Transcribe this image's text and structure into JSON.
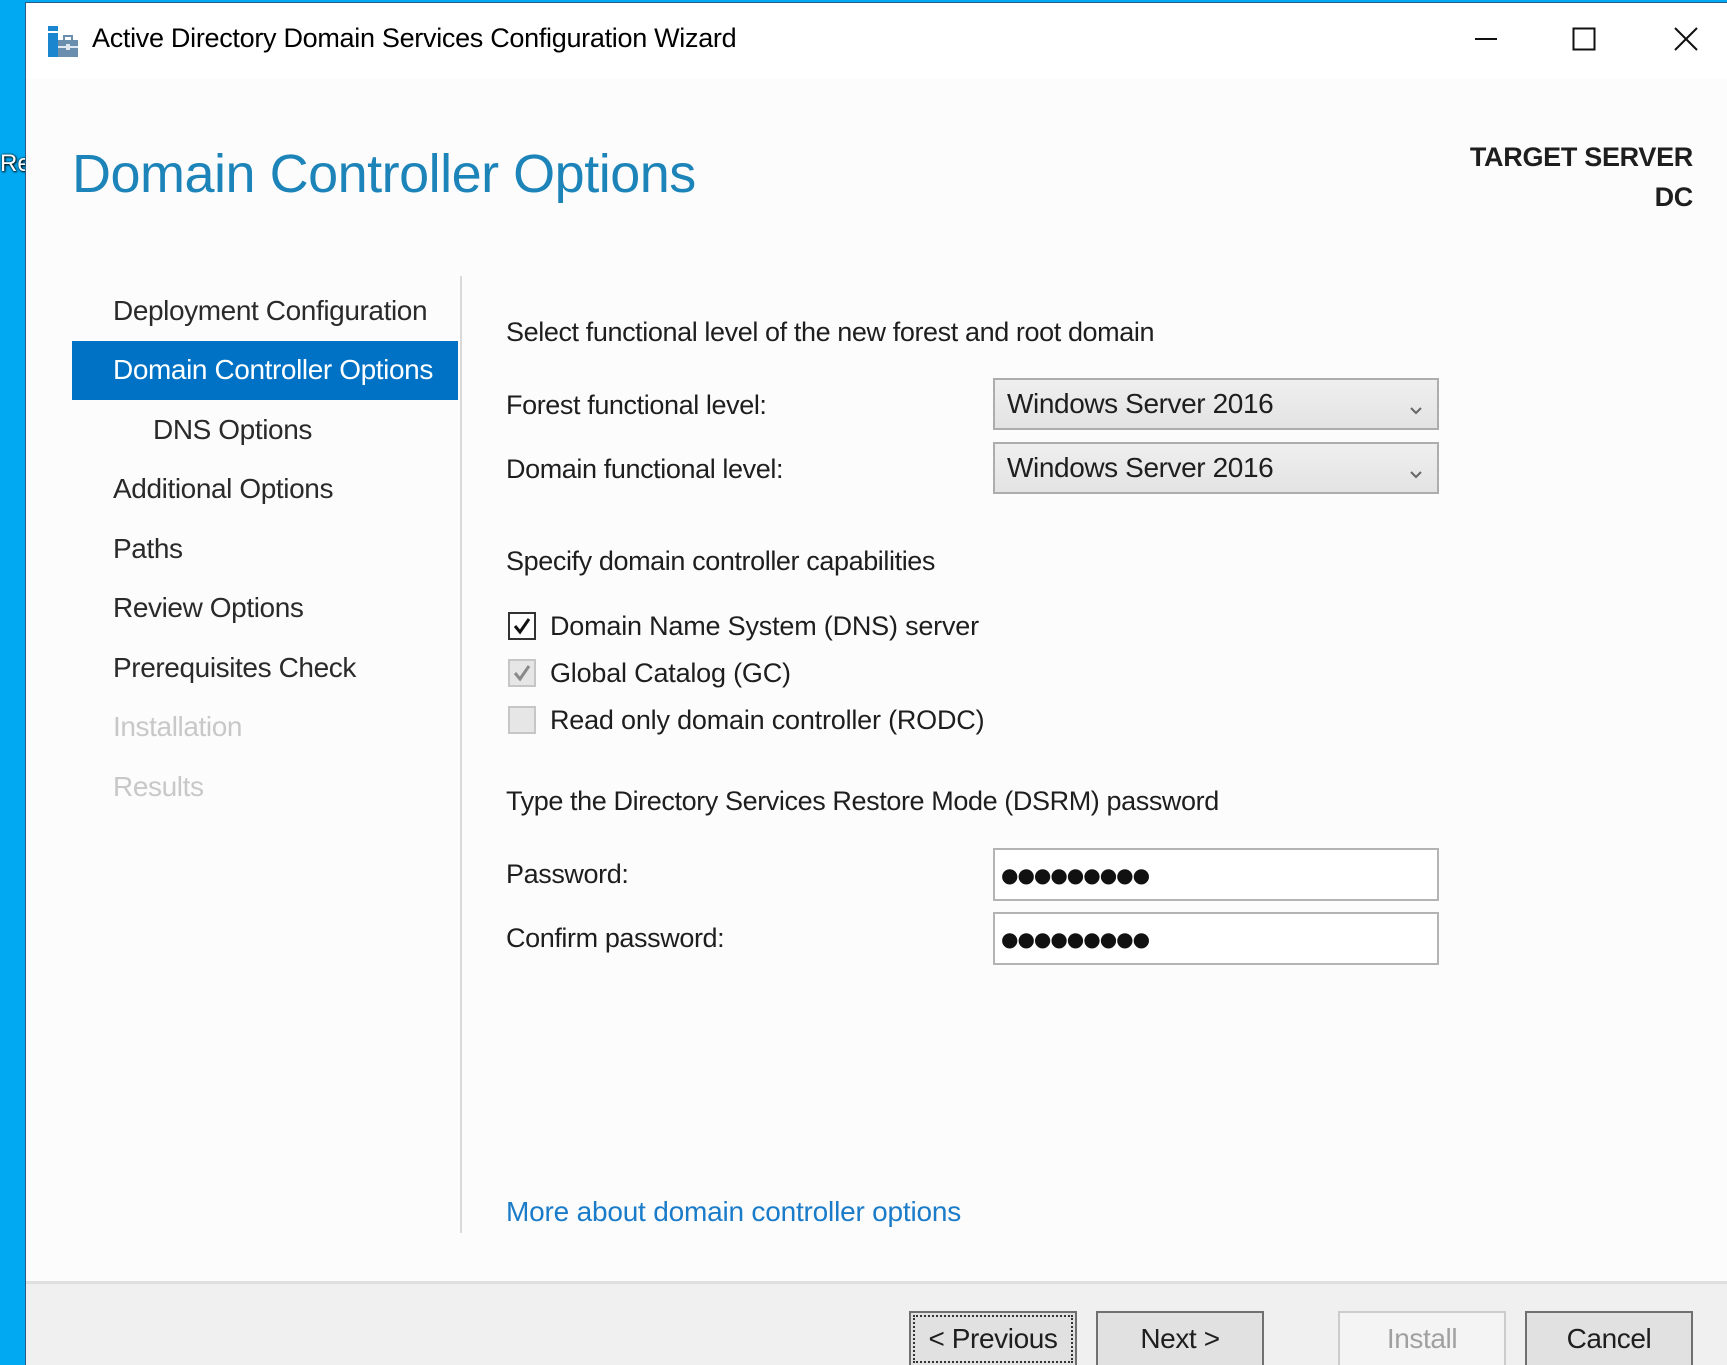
{
  "desktop": {
    "fragment_text": "Re",
    "background_color": "#00a9f2"
  },
  "window": {
    "title": "Active Directory Domain Services Configuration Wizard",
    "icon": "server-toolbox-icon",
    "controls": {
      "minimize": "minimize-icon",
      "maximize": "maximize-icon",
      "close": "close-icon"
    }
  },
  "header": {
    "page_title": "Domain Controller Options",
    "target_server_label": "TARGET SERVER",
    "target_server_name": "DC",
    "accent_color": "#1c84b8"
  },
  "sidebar": {
    "selected_color": "#0072c6",
    "items": [
      {
        "label": "Deployment Configuration",
        "state": "normal",
        "indent": false
      },
      {
        "label": "Domain Controller Options",
        "state": "selected",
        "indent": false
      },
      {
        "label": "DNS Options",
        "state": "normal",
        "indent": true
      },
      {
        "label": "Additional Options",
        "state": "normal",
        "indent": false
      },
      {
        "label": "Paths",
        "state": "normal",
        "indent": false
      },
      {
        "label": "Review Options",
        "state": "normal",
        "indent": false
      },
      {
        "label": "Prerequisites Check",
        "state": "normal",
        "indent": false
      },
      {
        "label": "Installation",
        "state": "disabled",
        "indent": false
      },
      {
        "label": "Results",
        "state": "disabled",
        "indent": false
      }
    ]
  },
  "main": {
    "functional_level_heading": "Select functional level of the new forest and root domain",
    "forest_level": {
      "label": "Forest functional level:",
      "value": "Windows Server 2016"
    },
    "domain_level": {
      "label": "Domain functional level:",
      "value": "Windows Server 2016"
    },
    "capabilities_heading": "Specify domain controller capabilities",
    "capabilities": [
      {
        "label": "Domain Name System (DNS) server",
        "checked": true,
        "enabled": true
      },
      {
        "label": "Global Catalog (GC)",
        "checked": true,
        "enabled": false
      },
      {
        "label": "Read only domain controller (RODC)",
        "checked": false,
        "enabled": false
      }
    ],
    "dsrm_heading": "Type the Directory Services Restore Mode (DSRM) password",
    "password": {
      "label": "Password:",
      "masked_value": "●●●●●●●●●"
    },
    "confirm_password": {
      "label": "Confirm password:",
      "masked_value": "●●●●●●●●●"
    },
    "help_link": "More about domain controller options",
    "link_color": "#1a7bc9"
  },
  "footer": {
    "previous_label": "< Previous",
    "next_label": "Next >",
    "install_label": "Install",
    "cancel_label": "Cancel"
  }
}
